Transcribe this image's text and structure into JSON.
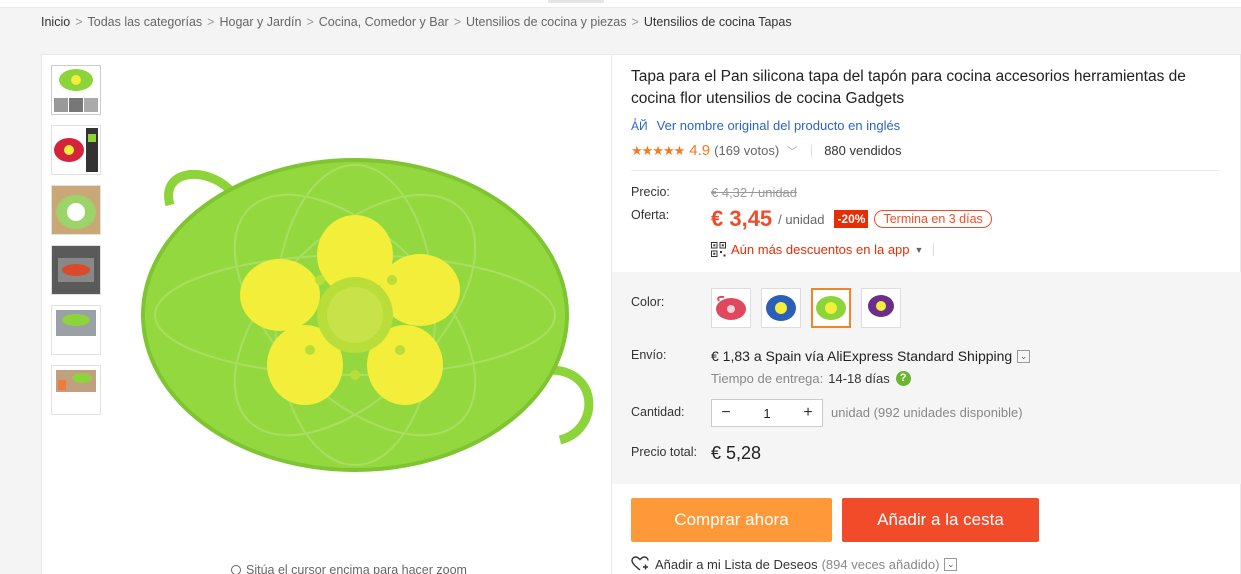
{
  "breadcrumb": [
    "Inicio",
    "Todas las categorías",
    "Hogar y Jardín",
    "Cocina, Comedor y Bar",
    "Utensilios de cocina y piezas",
    "Utensilios de cocina Tapas"
  ],
  "product": {
    "title": "Tapa para el Pan silicona tapa del tapón para cocina accesorios herramientas de cocina flor utensilios de cocina Gadgets",
    "original_link": "Ver nombre original del producto en inglés",
    "translate_icon_text": "A̓Й",
    "stars": "★★★★★",
    "rating": "4.9",
    "votes": "(169 votos)",
    "sold": "880 vendidos"
  },
  "pricing": {
    "price_label": "Precio:",
    "old_price": "€ 4,32 / unidad",
    "offer_label": "Oferta:",
    "price": "€ 3,45",
    "unit": "/ unidad",
    "discount": "-20%",
    "ends": "Termina en 3 días",
    "app_discounts": "Aún más descuentos en la app"
  },
  "options": {
    "color_label": "Color:",
    "colors": [
      "red",
      "blue",
      "green",
      "purple"
    ],
    "selected_color_index": 2,
    "shipping_label": "Envío:",
    "shipping": "€ 1,83 a Spain vía AliExpress Standard Shipping",
    "delivery_label": "Tiempo de entrega:",
    "delivery_days": "14-18 días",
    "help_icon": "?",
    "quantity_label": "Cantidad:",
    "quantity": "1",
    "minus": "−",
    "plus": "+",
    "quantity_note": "unidad (992 unidades disponible)",
    "total_label": "Precio total:",
    "total": "€ 5,28"
  },
  "actions": {
    "buy_now": "Comprar ahora",
    "add_to_cart": "Añadir a la cesta",
    "wishlist": "Añadir a mi Lista de Deseos",
    "wishlist_count": "(894 veces añadido)"
  },
  "gallery": {
    "zoom_hint": "Sitúa el cursor encima para hacer zoom",
    "thumbnail_count": 6
  },
  "colors": {
    "accent_orange": "#ff9838",
    "accent_red": "#f24b2a",
    "link_blue": "#2a64c8",
    "lid_green": "#8cd43a",
    "flower_yellow": "#f2ee3a"
  }
}
